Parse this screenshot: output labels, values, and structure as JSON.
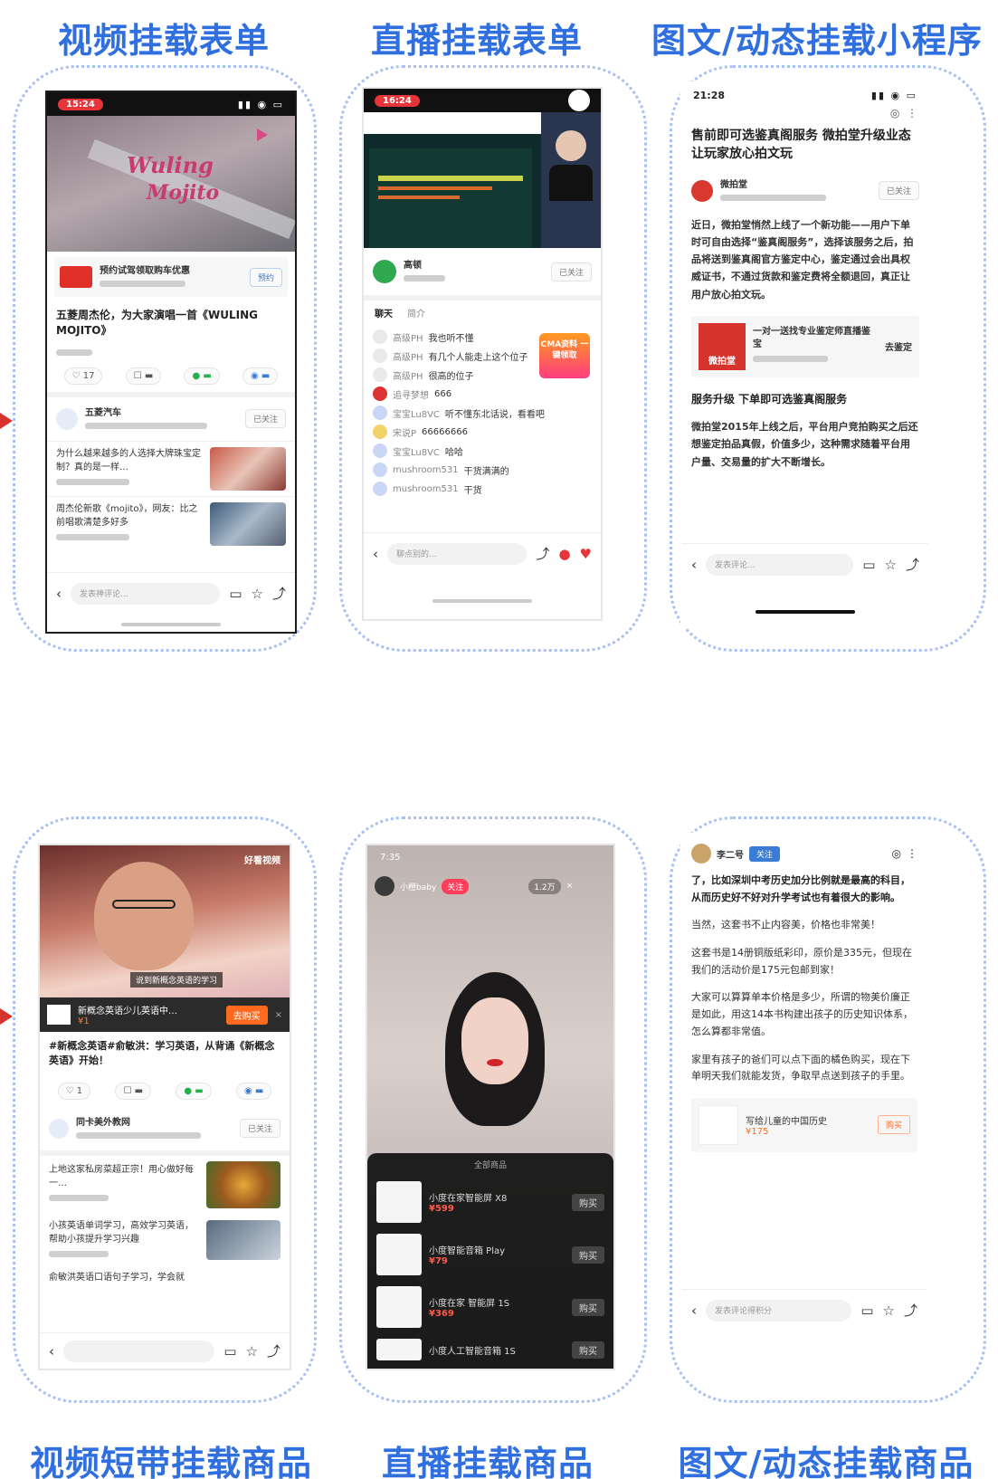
{
  "titles": {
    "t1": "视频挂载表单",
    "t2": "直播挂载表单",
    "t3": "图文/动态挂载小程序",
    "t4": "视频短带挂载商品",
    "t5": "直播挂载商品",
    "t6": "图文/动态挂载商品"
  },
  "colors": {
    "title": "#2f6fe0",
    "frame": "#a9c0f2",
    "accent": "#e8353a",
    "arrow": "#d6332d"
  },
  "p1": {
    "status_time": "15:24",
    "video_text_1": "Wuling",
    "video_text_2": "Mojito",
    "ad_title": "预约试驾领取购车优惠",
    "ad_button": "预约",
    "headline": "五菱周杰伦，为大家演唱一首《WULING MOJITO》",
    "count_like": "17",
    "author": "五菱汽车",
    "follow": "已关注",
    "rec1": "为什么越来越多的人选择大牌珠宝定制？真的是一样…",
    "rec2": "周杰伦新歌《mojito》，网友：比之前唱歌清楚多好多",
    "input_placeholder": "发表神评论..."
  },
  "p2": {
    "status_time": "16:24",
    "host_name": "高顿",
    "follow": "已关注",
    "tab1": "聊天",
    "tab2": "简介",
    "promo": "CMA资料 一键领取",
    "chat": [
      {
        "name": "高级PH",
        "text": "我也听不懂"
      },
      {
        "name": "高级PH",
        "text": "有几个人能走上这个位子"
      },
      {
        "name": "高级PH",
        "text": "很高的位子"
      },
      {
        "name": "追寻梦想",
        "text": "666"
      },
      {
        "name": "宝宝Lu8VC",
        "text": "听不懂东北话说，看看吧"
      },
      {
        "name": "宋说P",
        "text": "66666666"
      },
      {
        "name": "宝宝Lu8VC",
        "text": "哈哈"
      },
      {
        "name": "mushroom531",
        "text": "干货满满的"
      },
      {
        "name": "mushroom531",
        "text": "干货"
      }
    ],
    "input_placeholder": "聊点别的..."
  },
  "p3": {
    "status_time": "21:28",
    "headline": "售前即可选鉴真阁服务 微拍堂升级业态让玩家放心拍文玩",
    "author": "微拍堂",
    "follow": "已关注",
    "para1": "近日，微拍堂悄然上线了一个新功能——用户下单时可自由选择“鉴真阁服务”，选择该服务之后，拍品将送到鉴真阁官方鉴定中心，鉴定通过会出具权威证书，不通过货款和鉴定费将全额退回，真正让用户放心拍文玩。",
    "mini_title": "一对一送找专业鉴定师直播鉴宝",
    "mini_name": "微拍堂",
    "mini_button": "去鉴定",
    "subhead": "服务升级 下单即可选鉴真阁服务",
    "para2": "微拍堂2015年上线之后，平台用户竞拍购买之后还想鉴定拍品真假，价值多少，这种需求随着平台用户量、交易量的扩大不断增长。",
    "input_placeholder": "发表评论..."
  },
  "p4": {
    "brand": "好看视频",
    "caption": "说到新概念英语的学习",
    "goods_title": "新概念英语少儿英语中…",
    "goods_price": "¥1",
    "goods_button": "去购买",
    "headline": "#新概念英语#俞敏洪：学习英语，从背诵《新概念英语》开始！",
    "author": "同卡美外教网",
    "follow": "已关注",
    "rec1": "上地这家私房菜超正宗！用心做好每一…",
    "rec2": "小孩英语单词学习，高效学习英语，帮助小孩提升学习兴趣",
    "rec3": "俞敏洪英语口语句子学习，学会就",
    "count_like": "1"
  },
  "p5": {
    "status_time": "7:35",
    "host": "小橙baby",
    "follow": "关注",
    "viewers": "1.2万",
    "list_title": "全部商品",
    "products": [
      {
        "name": "小度在家智能屏 X8",
        "price": "¥599",
        "btn": "购买"
      },
      {
        "name": "小度智能音箱 Play",
        "price": "¥79",
        "btn": "购买"
      },
      {
        "name": "小度在家 智能屏 1S",
        "price": "¥369",
        "btn": "购买"
      },
      {
        "name": "小度人工智能音箱 1S",
        "price": "",
        "btn": "购买"
      }
    ]
  },
  "p6": {
    "author": "李二号",
    "follow": "关注",
    "para1": "了，比如深圳中考历史加分比例就是最高的科目，从而历史好不好对升学考试也有着很大的影响。",
    "para2": "当然，这套书不止内容美，价格也非常美！",
    "para3": "这套书是14册铜版纸彩印，原价是335元，但现在我们的活动价是175元包邮到家！",
    "para4": "大家可以算算单本价格是多少，所谓的物美价廉正是如此，用这14本书构建出孩子的历史知识体系，怎么算都非常值。",
    "para5": "家里有孩子的爸们可以点下面的橘色购买，现在下单明天我们就能发货，争取早点送到孩子的手里。",
    "goods_title": "写给儿童的中国历史",
    "goods_price": "¥175",
    "goods_button": "购买",
    "input_placeholder": "发表评论得积分"
  }
}
